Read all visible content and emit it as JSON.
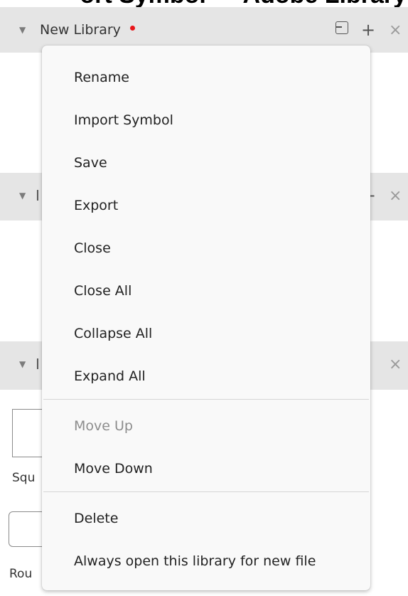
{
  "top_strip": {
    "text": "ort Symbol — Adobe Library"
  },
  "sections": {
    "first": {
      "title": "New Library"
    },
    "second": {
      "title": ""
    },
    "third": {
      "title": ""
    }
  },
  "side_labels": {
    "squ": "Squ",
    "rou": "Rou"
  },
  "menu": {
    "rename": "Rename",
    "import_symbol": "Import Symbol",
    "save": "Save",
    "export": "Export",
    "close": "Close",
    "close_all": "Close All",
    "collapse_all": "Collapse All",
    "expand_all": "Expand All",
    "move_up": "Move Up",
    "move_down": "Move Down",
    "delete": "Delete",
    "always_open": "Always open this library for new file"
  },
  "colors": {
    "header_bg": "#e5e5e5",
    "menu_bg": "#f9f9f9",
    "unsaved_dot": "#e8151a",
    "disabled_text": "#8d8d8d"
  },
  "icons": {
    "caret": "triangle-down",
    "import": "import-icon",
    "add": "plus-icon",
    "close": "close-icon"
  }
}
